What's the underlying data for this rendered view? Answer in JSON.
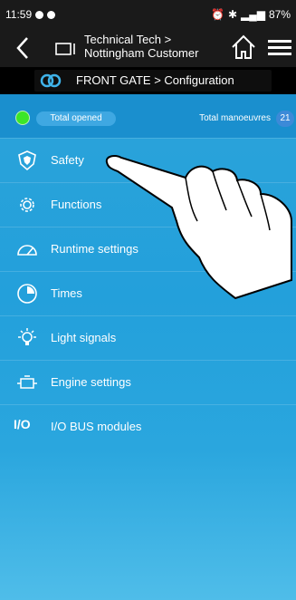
{
  "status_bar": {
    "time": "11:59",
    "battery": "87%"
  },
  "header": {
    "breadcrumb_line1": "Technical Tech >",
    "breadcrumb_line2": "Nottingham Customer"
  },
  "subheader": {
    "title": "FRONT GATE > Configuration"
  },
  "gate_status": {
    "state": "Total opened",
    "manoeuvres_label": "Total manoeuvres",
    "manoeuvres_count": "21",
    "led_color": "#3ce629"
  },
  "menu": {
    "items": [
      {
        "label": "Safety",
        "icon": "shield-icon"
      },
      {
        "label": "Functions",
        "icon": "gear-icon"
      },
      {
        "label": "Runtime settings",
        "icon": "gauge-icon"
      },
      {
        "label": "Times",
        "icon": "clock-icon"
      },
      {
        "label": "Light signals",
        "icon": "lightbulb-icon"
      },
      {
        "label": "Engine settings",
        "icon": "engine-icon"
      },
      {
        "label": "I/O BUS modules",
        "icon": "io-icon"
      }
    ]
  },
  "colors": {
    "accent": "#23a0db",
    "header_bg": "#1a1a1a"
  }
}
